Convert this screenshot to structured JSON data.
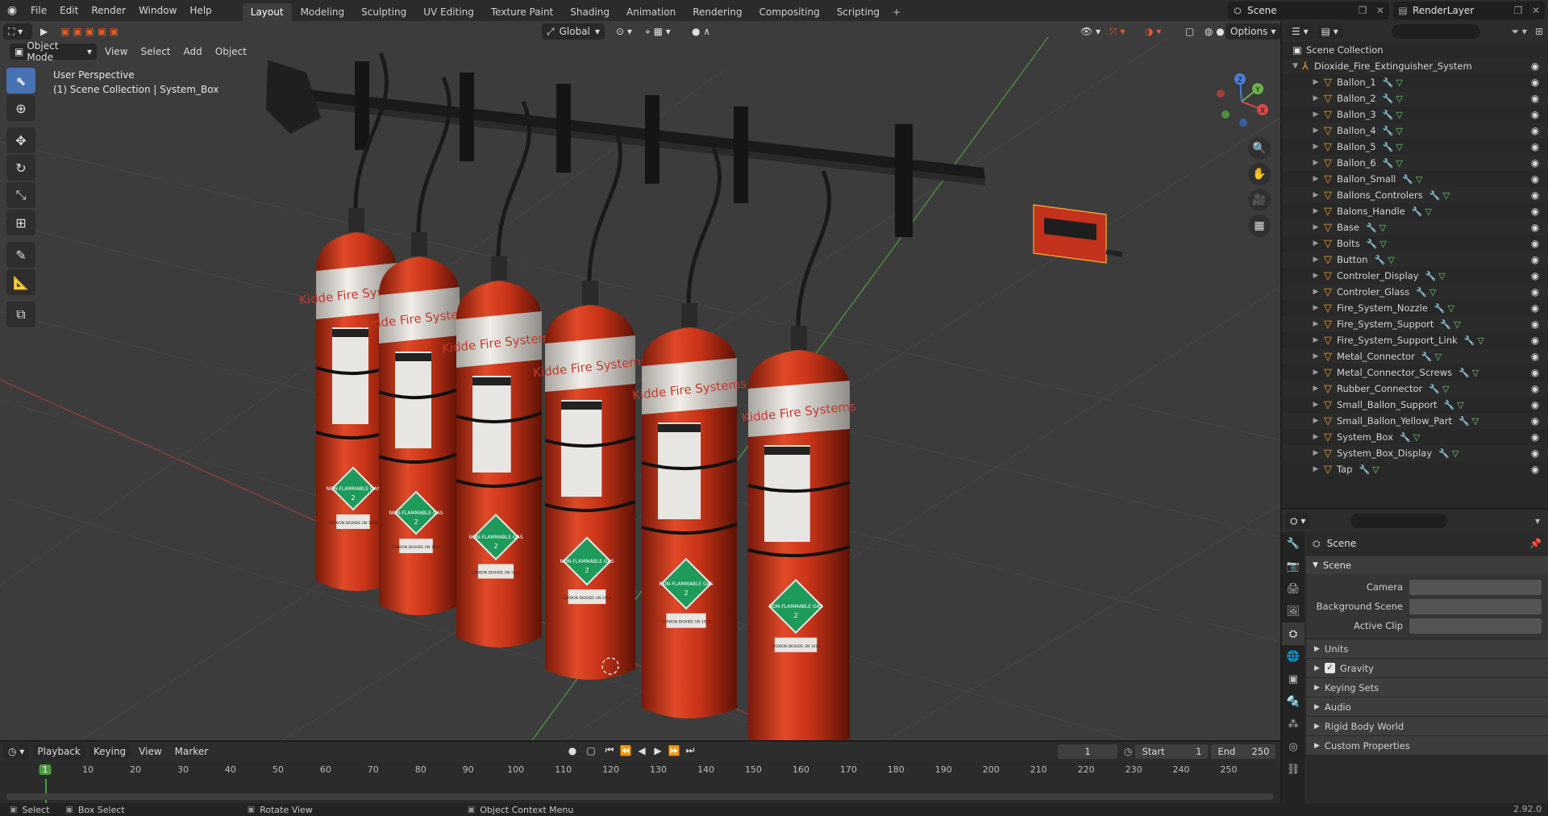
{
  "topbar": {
    "menus": [
      "File",
      "Edit",
      "Render",
      "Window",
      "Help"
    ],
    "workspaces": [
      "Layout",
      "Modeling",
      "Sculpting",
      "UV Editing",
      "Texture Paint",
      "Shading",
      "Animation",
      "Rendering",
      "Compositing",
      "Scripting"
    ],
    "active_workspace": "Layout",
    "scene_name": "Scene",
    "view_layer": "RenderLayer"
  },
  "viewport": {
    "mode": "Object Mode",
    "menus": [
      "View",
      "Select",
      "Add",
      "Object"
    ],
    "transform_orientation": "Global",
    "options_label": "Options",
    "perspective_label": "User Perspective",
    "context_label": "(1) Scene Collection | System_Box",
    "tank_label": "Kidde Fire Systems",
    "diamond_label": "NON-FLAMMABLE GAS",
    "diamond_number": "2",
    "gas_label": "CARBON DIOXIDE UN 1013",
    "gizmo": {
      "x": "X",
      "y": "Y",
      "z": "Z"
    },
    "colors": {
      "tank": "#c93418",
      "band": "#e8e4df",
      "diamond": "#1e9a5a",
      "selection": "#f0a030"
    }
  },
  "outliner": {
    "search_placeholder": "",
    "root": "Scene Collection",
    "collection": "Dioxide_Fire_Extinguisher_System",
    "objects": [
      "Ballon_1",
      "Ballon_2",
      "Ballon_3",
      "Ballon_4",
      "Ballon_5",
      "Ballon_6",
      "Ballon_Small",
      "Ballons_Controlers",
      "Balons_Handle",
      "Base",
      "Bolts",
      "Button",
      "Controler_Display",
      "Controler_Glass",
      "Fire_System_Nozzle",
      "Fire_System_Support",
      "Fire_System_Support_Link",
      "Metal_Connector",
      "Metal_Connector_Screws",
      "Rubber_Connector",
      "Small_Ballon_Support",
      "Small_Ballon_Yellow_Part",
      "System_Box",
      "System_Box_Display",
      "Tap"
    ]
  },
  "properties": {
    "context": "Scene",
    "panel": "Scene",
    "fields": [
      {
        "label": "Camera",
        "value": ""
      },
      {
        "label": "Background Scene",
        "value": ""
      },
      {
        "label": "Active Clip",
        "value": ""
      }
    ],
    "subpanels": [
      "Units",
      "Gravity",
      "Keying Sets",
      "Audio",
      "Rigid Body World",
      "Custom Properties"
    ],
    "gravity_checked": true
  },
  "timeline": {
    "menus": [
      "Playback",
      "Keying",
      "View",
      "Marker"
    ],
    "current_frame": "1",
    "start_label": "Start",
    "start": "1",
    "end_label": "End",
    "end": "250",
    "ticks": [
      "1",
      "10",
      "20",
      "30",
      "40",
      "50",
      "60",
      "70",
      "80",
      "90",
      "100",
      "110",
      "120",
      "130",
      "140",
      "150",
      "160",
      "170",
      "180",
      "190",
      "200",
      "210",
      "220",
      "230",
      "240",
      "250"
    ]
  },
  "statusbar": {
    "items": [
      "Select",
      "Box Select",
      "Rotate View",
      "Object Context Menu"
    ],
    "version": "2.92.0"
  }
}
